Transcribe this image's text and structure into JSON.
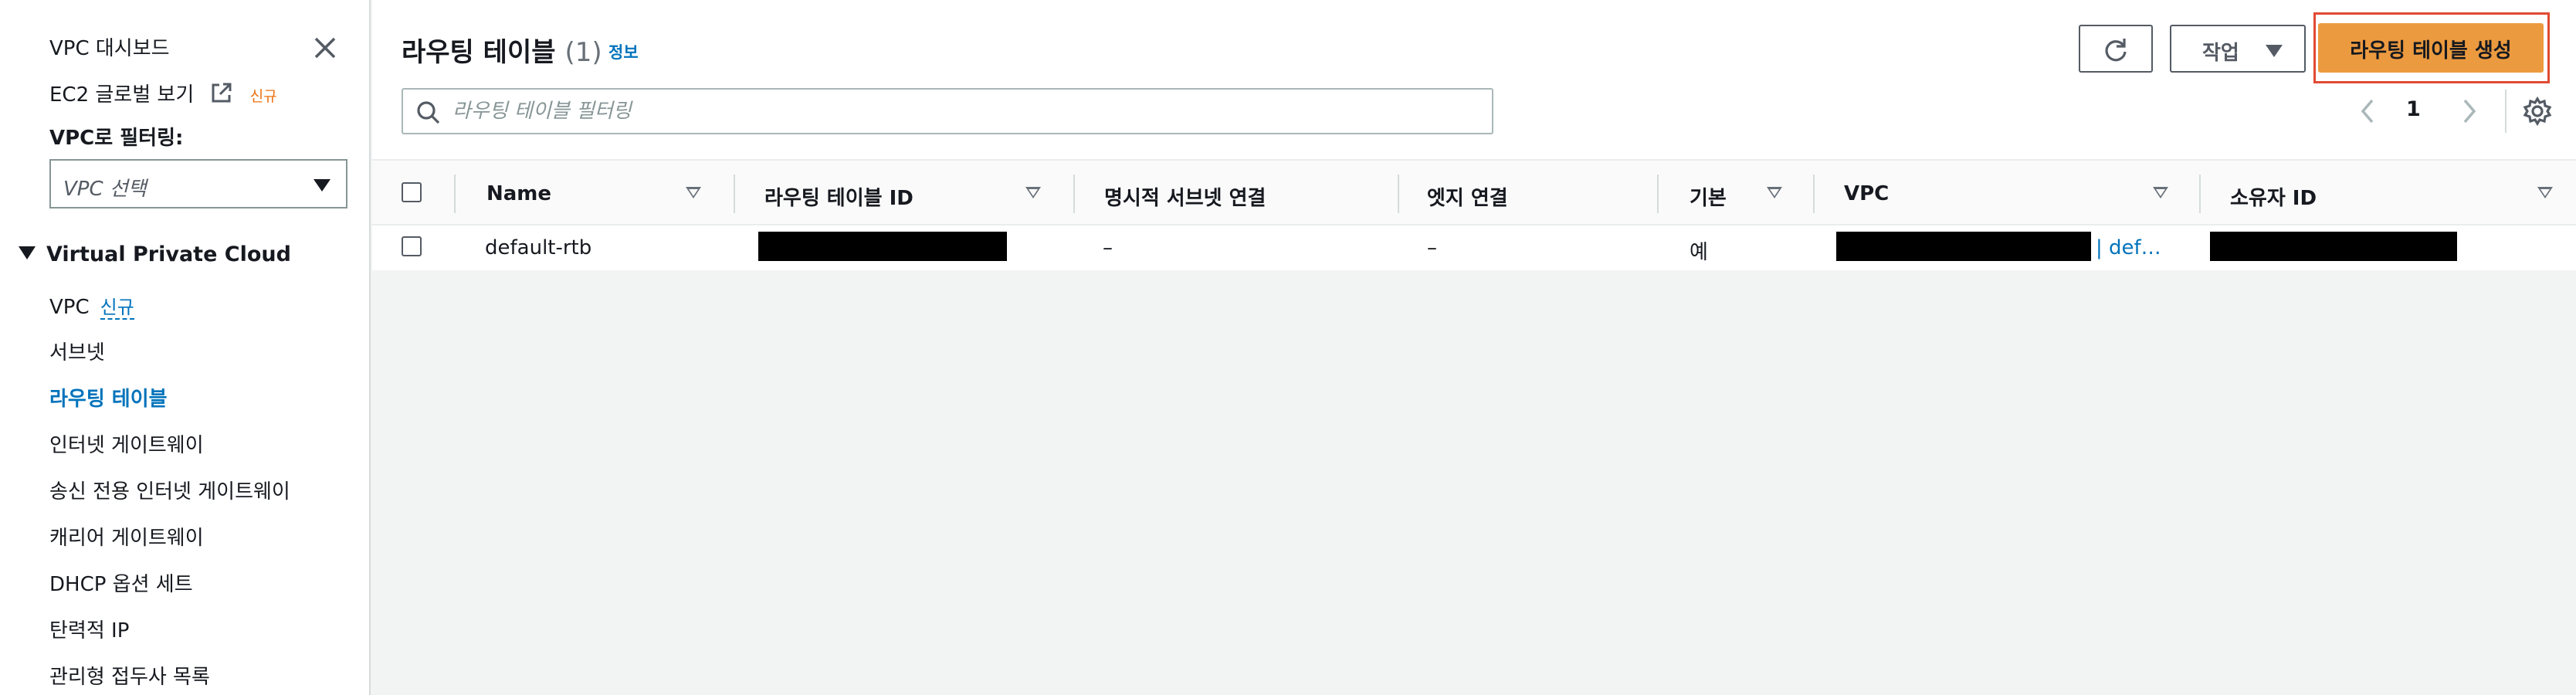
{
  "sidebar": {
    "dashboard": "VPC 대시보드",
    "ec2_global_view": "EC2 글로벌 보기",
    "ec2_global_view_badge": "신규",
    "filter_label": "VPC로 필터링:",
    "vpc_select_placeholder": "VPC 선택",
    "section_title": "Virtual Private Cloud",
    "items": [
      {
        "label": "VPC",
        "badge": "신규"
      },
      {
        "label": "서브넷"
      },
      {
        "label": "라우팅 테이블",
        "active": true
      },
      {
        "label": "인터넷 게이트웨이"
      },
      {
        "label": "송신 전용 인터넷 게이트웨이"
      },
      {
        "label": "캐리어 게이트웨이"
      },
      {
        "label": "DHCP 옵션 세트"
      },
      {
        "label": "탄력적 IP"
      },
      {
        "label": "관리형 접두사 목록"
      }
    ]
  },
  "header": {
    "title": "라우팅 테이블",
    "count": "(1)",
    "info": "정보",
    "actions_label": "작업",
    "create_label": "라우팅 테이블 생성"
  },
  "search": {
    "placeholder": "라우팅 테이블 필터링",
    "value": ""
  },
  "pagination": {
    "current_page": "1"
  },
  "table": {
    "columns": [
      "Name",
      "라우팅 테이블 ID",
      "명시적 서브넷 연결",
      "엣지 연결",
      "기본",
      "VPC",
      "소유자 ID"
    ],
    "rows": [
      {
        "name": "default-rtb",
        "route_table_id": "",
        "explicit_subnet": "–",
        "edge": "–",
        "main": "예",
        "vpc_suffix": "| def…",
        "owner_id": ""
      }
    ]
  },
  "colors": {
    "accent": "#0073bb",
    "primary_button": "#ec9a3f",
    "highlight": "#e04a33",
    "new_badge": "#ec7211"
  }
}
